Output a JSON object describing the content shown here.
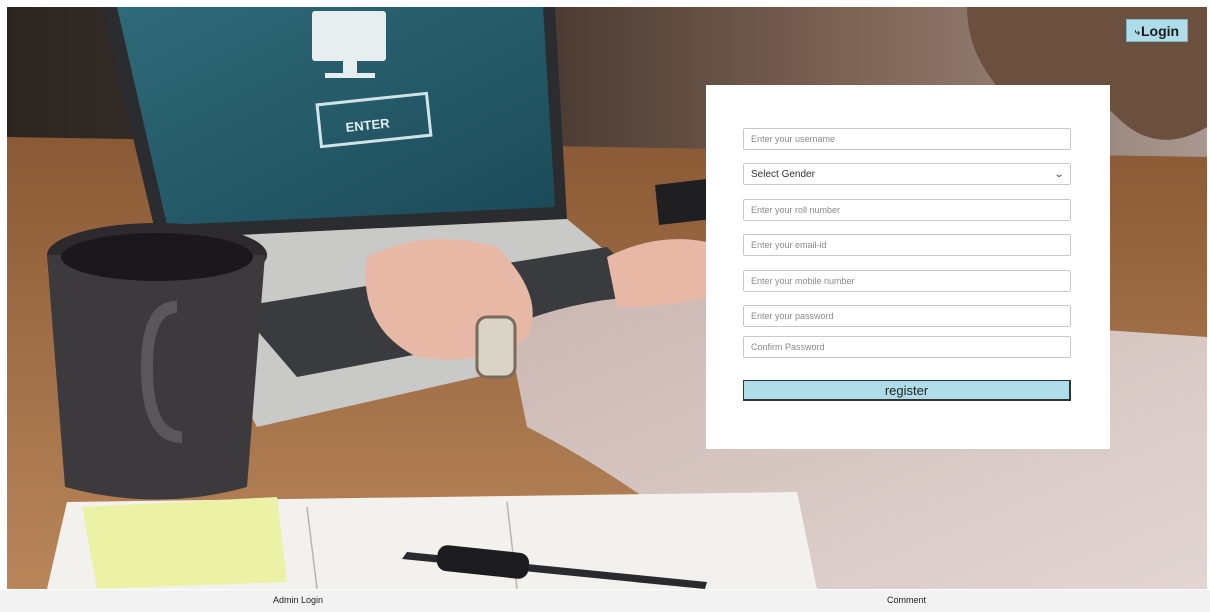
{
  "header": {
    "login_icon": "login-arrow-icon",
    "login_label": "Login"
  },
  "form": {
    "username_placeholder": "Enter your username",
    "gender_selected": "Select Gender",
    "roll_placeholder": "Enter your roll number",
    "email_placeholder": "Enter your email-id",
    "mobile_placeholder": "Enter your mobile number",
    "password_placeholder": "Enter your password",
    "confirm_placeholder": "Confirm Password",
    "register_label": "register"
  },
  "background": {
    "screen_button_label": "ENTER"
  },
  "footer": {
    "admin_login": "Admin Login",
    "comment": "Comment"
  },
  "colors": {
    "accent": "#aedce9",
    "card": "#ffffff",
    "footer": "#f2f2f2"
  }
}
